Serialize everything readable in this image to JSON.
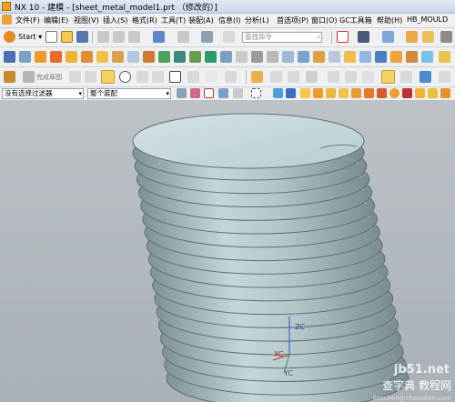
{
  "window": {
    "title": "NX 10 - 建模 - [sheet_metal_model1.prt （修改的）]"
  },
  "menu": {
    "items": [
      "文件(F)",
      "编辑(E)",
      "视图(V)",
      "插入(S)",
      "格式(R)",
      "工具(T)",
      "装配(A)",
      "信息(I)",
      "分析(L)",
      "首选项(P)",
      "窗口(O)",
      "GC工具箱",
      "帮助(H)",
      "HB_MOULD"
    ]
  },
  "toolbar1": {
    "start_label": "Start ▾",
    "search_placeholder": "查找命令"
  },
  "toolbar3": {
    "finish_sketch_label": "完成草图"
  },
  "selection_bar": {
    "filter_value": "没有选择过滤器",
    "scope_value": "整个装配"
  },
  "triad": {
    "zc": "ZC",
    "xc": "XC",
    "yc": "YC"
  },
  "watermark": {
    "line1": "jb51.net",
    "line2": "查字典 教程网",
    "line3": "jiaocheng.chazidian.com"
  },
  "colors": {
    "part_face": "#c3d6d9",
    "part_edge": "#5e6f75",
    "viewport_bg": "#b3b9be",
    "accent_orange": "#f0a020"
  }
}
